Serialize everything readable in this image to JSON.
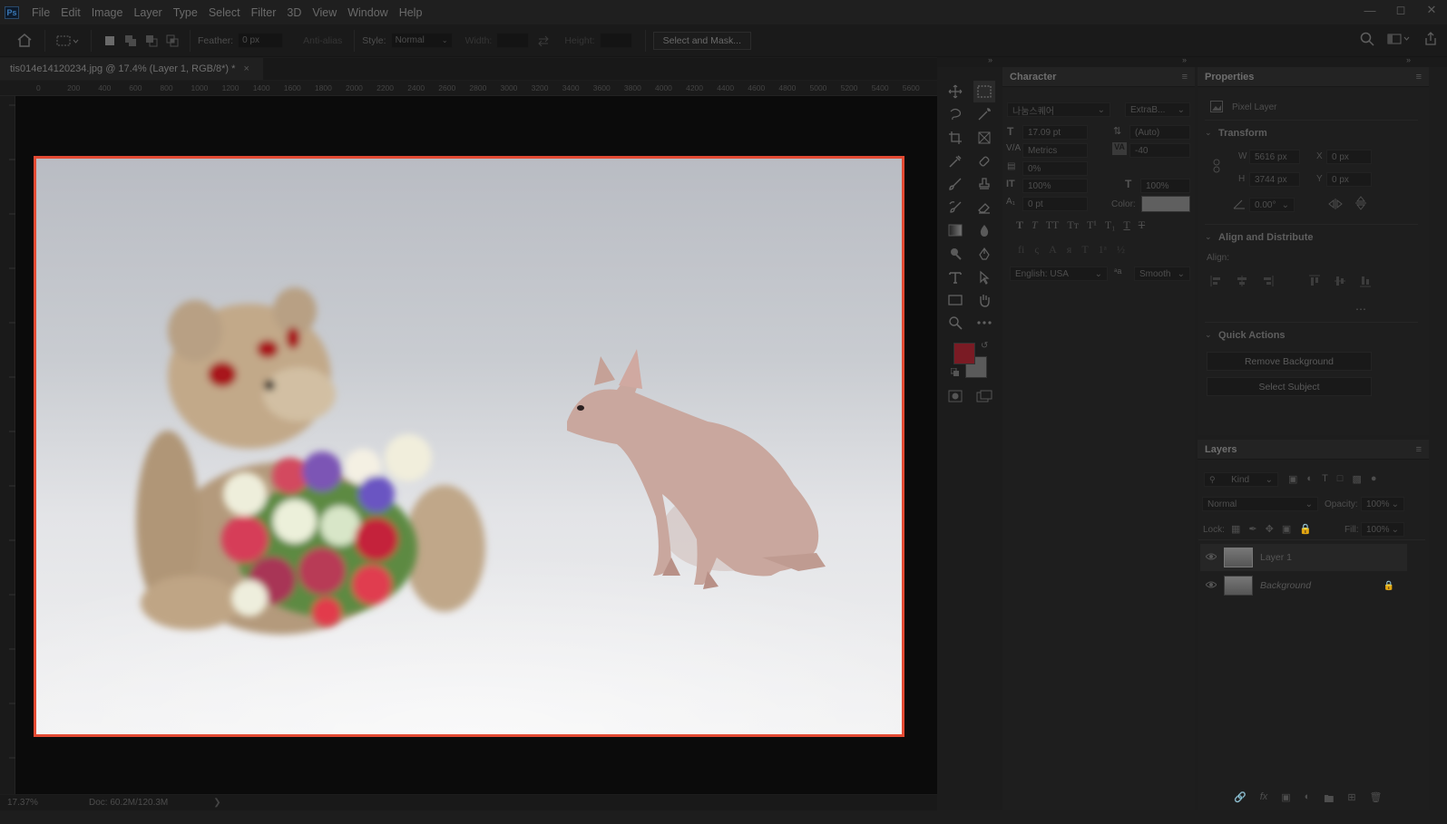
{
  "app": {
    "logo_text": "Ps"
  },
  "menu": [
    "File",
    "Edit",
    "Image",
    "Layer",
    "Type",
    "Select",
    "Filter",
    "3D",
    "View",
    "Window",
    "Help"
  ],
  "options_bar": {
    "feather_label": "Feather:",
    "feather_value": "0 px",
    "anti_alias_label": "Anti-alias",
    "style_label": "Style:",
    "style_value": "Normal",
    "width_label": "Width:",
    "height_label": "Height:",
    "select_mask_label": "Select and Mask..."
  },
  "document": {
    "tab_title": "tis014e14120234.jpg @ 17.4% (Layer 1, RGB/8*) *",
    "ruler_h": [
      "0",
      "200",
      "400",
      "600",
      "800",
      "1000",
      "1200",
      "1400",
      "1600",
      "1800",
      "2000",
      "2200",
      "2400",
      "2600",
      "2800",
      "3000",
      "3200",
      "3400",
      "3600",
      "3800",
      "4000",
      "4200",
      "4400",
      "4600",
      "4800",
      "5000",
      "5200",
      "5400",
      "5600"
    ]
  },
  "status": {
    "zoom": "17.37%",
    "doc": "Doc: 60.2M/120.3M"
  },
  "character": {
    "title": "Character",
    "font_family": "나눔스퀘어",
    "font_style": "ExtraB...",
    "font_size": "17.09 pt",
    "leading": "(Auto)",
    "kerning": "Metrics",
    "tracking": "-40",
    "tsume": "0%",
    "vscale": "100%",
    "hscale": "100%",
    "baseline": "0 pt",
    "color_label": "Color:",
    "language": "English: USA",
    "antialias": "Smooth"
  },
  "properties": {
    "title": "Properties",
    "kind": "Pixel Layer",
    "transform_title": "Transform",
    "w_label": "W",
    "w_value": "5616 px",
    "h_label": "H",
    "h_value": "3744 px",
    "x_label": "X",
    "x_value": "0 px",
    "y_label": "Y",
    "y_value": "0 px",
    "angle_value": "0.00°",
    "align_title": "Align and Distribute",
    "align_label": "Align:",
    "quick_title": "Quick Actions",
    "remove_bg": "Remove Background",
    "select_subject": "Select Subject"
  },
  "layers": {
    "title": "Layers",
    "filter_kind": "Kind",
    "blend_mode": "Normal",
    "opacity_label": "Opacity:",
    "opacity_value": "100%",
    "lock_label": "Lock:",
    "fill_label": "Fill:",
    "fill_value": "100%",
    "items": [
      {
        "name": "Layer 1",
        "visible": true,
        "selected": true
      },
      {
        "name": "Background",
        "visible": true,
        "locked": true
      }
    ]
  },
  "colors": {
    "accent_frame": "#e34a33",
    "foreground": "#7a1b24",
    "background": "#5a5a5a"
  }
}
